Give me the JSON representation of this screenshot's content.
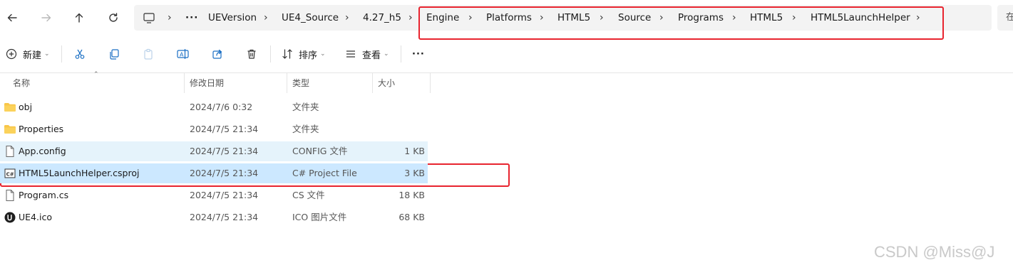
{
  "nav": {
    "more_label": "···",
    "breadcrumbs": [
      "UEVersion",
      "UE4_Source",
      "4.27_h5",
      "Engine",
      "Platforms",
      "HTML5",
      "Source",
      "Programs",
      "HTML5",
      "HTML5LaunchHelper"
    ],
    "search_placeholder": "在"
  },
  "toolbar": {
    "new_label": "新建",
    "sort_label": "排序",
    "view_label": "查看",
    "more_label": "···"
  },
  "columns": {
    "name": "名称",
    "date": "修改日期",
    "type": "类型",
    "size": "大小"
  },
  "files": [
    {
      "name": "obj",
      "date": "2024/7/6 0:32",
      "type": "文件夹",
      "size": "",
      "icon": "folder-icon"
    },
    {
      "name": "Properties",
      "date": "2024/7/5 21:34",
      "type": "文件夹",
      "size": "",
      "icon": "folder-icon"
    },
    {
      "name": "App.config",
      "date": "2024/7/5 21:34",
      "type": "CONFIG 文件",
      "size": "1 KB",
      "icon": "file-icon"
    },
    {
      "name": "HTML5LaunchHelper.csproj",
      "date": "2024/7/5 21:34",
      "type": "C# Project File",
      "size": "3 KB",
      "icon": "csproj-icon"
    },
    {
      "name": "Program.cs",
      "date": "2024/7/5 21:34",
      "type": "CS 文件",
      "size": "18 KB",
      "icon": "file-icon"
    },
    {
      "name": "UE4.ico",
      "date": "2024/7/5 21:34",
      "type": "ICO 图片文件",
      "size": "68 KB",
      "icon": "ue-logo-icon"
    }
  ],
  "colors": {
    "annotation_red": "#e8242f",
    "selection": "#cce8ff",
    "hover": "#e5f3fb",
    "folder": "#f8c649"
  },
  "watermark": "CSDN @Miss@J"
}
